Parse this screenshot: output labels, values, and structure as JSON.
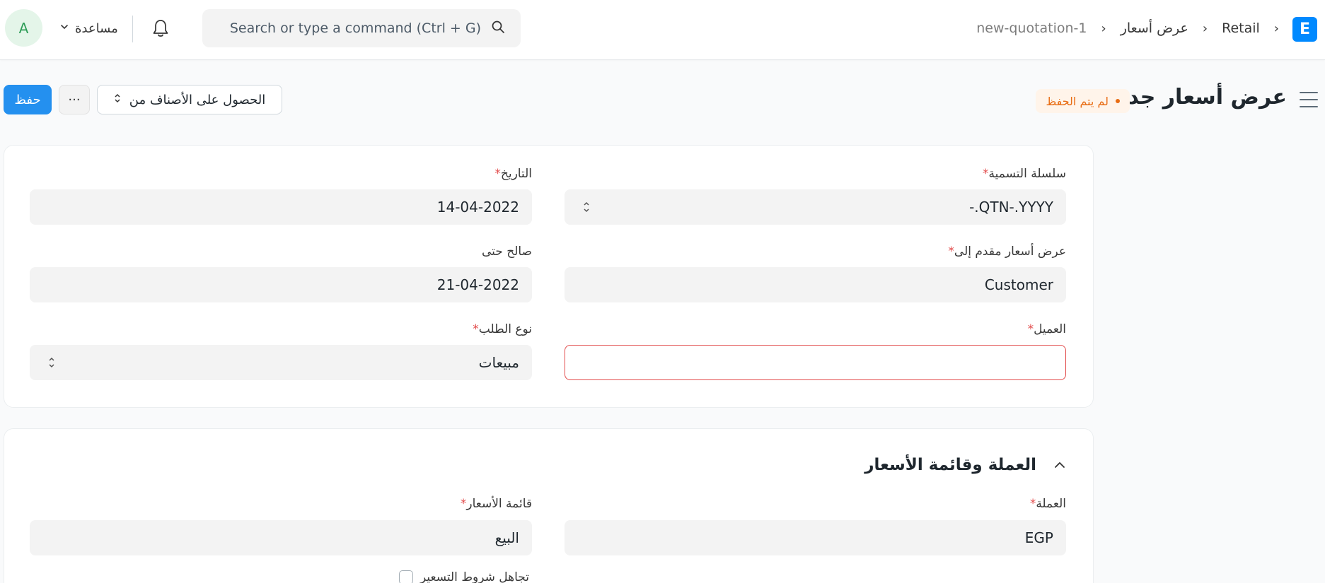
{
  "navbar": {
    "logo_letter": "E",
    "breadcrumb": [
      "Retail",
      "عرض أسعار",
      "new-quotation-1"
    ],
    "search_placeholder": "Search or type a command (Ctrl + G)",
    "help_label": "مساعدة",
    "avatar_letter": "A"
  },
  "page": {
    "title": "عرض أسعار جديد",
    "status": "لم يتم الحفظ",
    "save_label": "حفظ",
    "more_label": "···",
    "get_items_label": "الحصول على الأصناف من"
  },
  "card1": {
    "naming_series": {
      "label": "سلسلة التسمية",
      "value": "-.QTN-.YYYY"
    },
    "date": {
      "label": "التاريخ",
      "value": "14-04-2022"
    },
    "quotation_to": {
      "label": "عرض أسعار مقدم إلى",
      "value": "Customer"
    },
    "valid_till": {
      "label": "صالح حتى",
      "value": "21-04-2022"
    },
    "customer": {
      "label": "العميل",
      "value": ""
    },
    "order_type": {
      "label": "نوع الطلب",
      "value": "مبيعات"
    }
  },
  "card2": {
    "section_title": "العملة وقائمة الأسعار",
    "currency": {
      "label": "العملة",
      "value": "EGP"
    },
    "price_list": {
      "label": "قائمة الأسعار",
      "value": "البيع"
    },
    "ignore_pricing_rule": "تجاهل شروط التسعير"
  },
  "colors": {
    "primary": "#2490ef",
    "logo": "#0089ff",
    "warning": "#e86c13",
    "error": "#e24c4c"
  }
}
